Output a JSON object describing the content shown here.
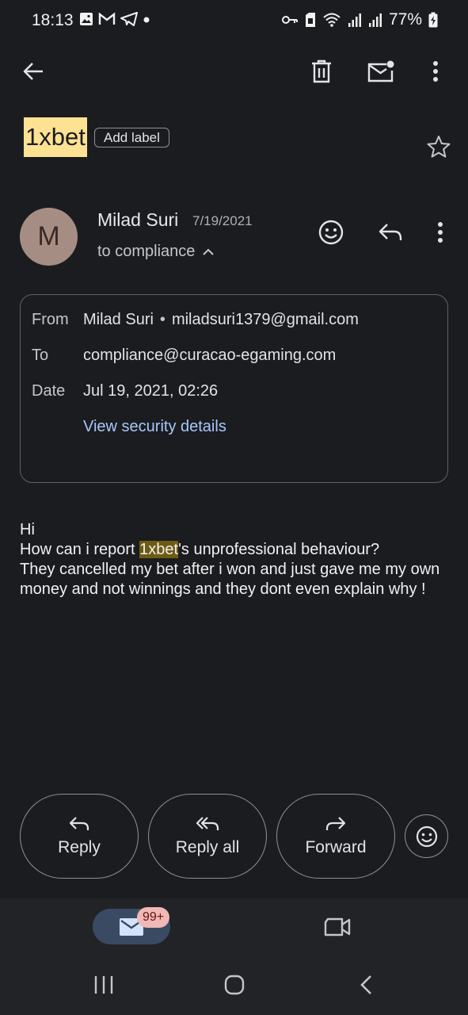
{
  "status_bar": {
    "time": "18:13",
    "battery": "77%"
  },
  "top_bar": {
    "back_icon": "arrow-back-icon",
    "delete_icon": "trash-icon",
    "mark_unread_icon": "mail-unread-icon",
    "more_icon": "more-vert-icon"
  },
  "subject": {
    "text": "1xbet",
    "add_label": "Add label"
  },
  "sender": {
    "initial": "M",
    "name": "Milad Suri",
    "date": "7/19/2021",
    "to_line": "to compliance"
  },
  "details": {
    "from_label": "From",
    "from_name": "Milad Suri",
    "separator": "•",
    "from_email": "miladsuri1379@gmail.com",
    "to_label": "To",
    "to_email": "compliance@curacao-egaming.com",
    "date_label": "Date",
    "date_value": "Jul 19, 2021, 02:26",
    "security_link": "View security details"
  },
  "body": {
    "greeting": "Hi",
    "line_pre": "How can i report ",
    "highlight": "1xbet",
    "line_post": "'s unprofessional behaviour?",
    "rest": "They cancelled my bet after i won and just gave me my own money and not winnings and they dont even explain why !"
  },
  "actions": {
    "reply": "Reply",
    "reply_all": "Reply all",
    "forward": "Forward"
  },
  "bottom_nav": {
    "badge": "99+"
  },
  "colors": {
    "background": "#1b1c20",
    "subject_highlight": "#fde293",
    "body_highlight": "#6e5b13",
    "link": "#a8c7fa",
    "avatar": "#a68d84",
    "badge": "#f2b8b5"
  }
}
